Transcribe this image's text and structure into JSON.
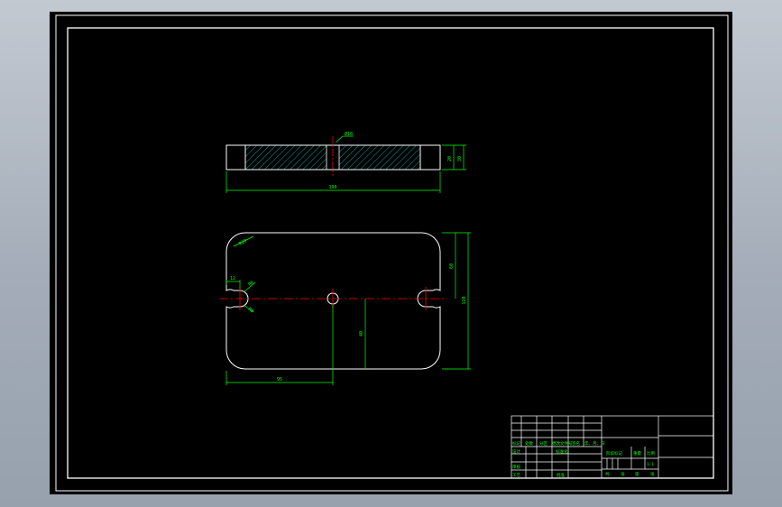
{
  "drawing": {
    "background": "#000000",
    "colors": {
      "outline": "#ffffff",
      "dimension": "#00ff00",
      "centerline": "#ff0000",
      "hatch": "#00c8c8",
      "viewport": "#a9b1bc"
    },
    "front_view": {
      "overall_width_label": "190",
      "thickness_label": "20",
      "height_label": "30",
      "hole_label": "Ø10"
    },
    "plan_view": {
      "corner_radius_label": "R20",
      "slot_width_label": "12",
      "slot_radius_label": "R6",
      "slot_depth_label": "R8",
      "hole_offset_label": "95",
      "half_height_label": "60",
      "offset_height_label": "40",
      "total_height_label": "120"
    },
    "title_block": {
      "row_labels": [
        "标记",
        "处数",
        "分区",
        "更改文件号",
        "签名",
        "年、月、日"
      ],
      "design_label": "设计",
      "standard_label": "标准化",
      "audit_label": "审核",
      "process_label": "工艺",
      "approve_label": "批准",
      "stage_label": "阶段标记",
      "weight_label": "重量",
      "scale_label": "比例",
      "scale_value": "1:1",
      "sheet_labels": [
        "共",
        "张",
        "第",
        "张"
      ]
    }
  }
}
